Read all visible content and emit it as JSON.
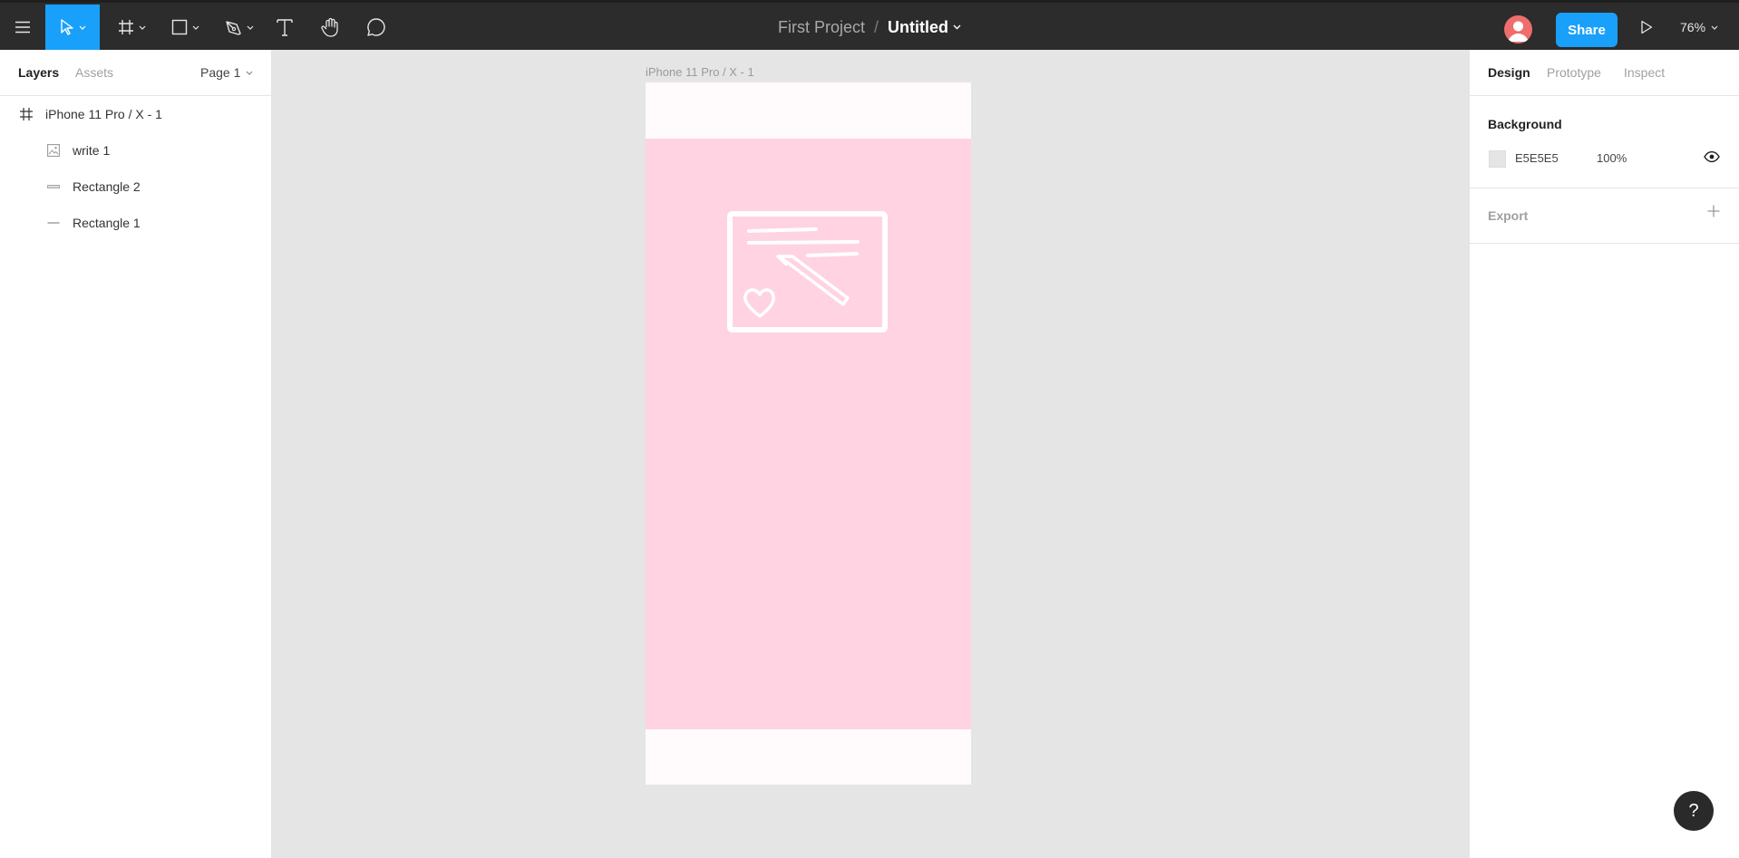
{
  "toolbar": {
    "project_name": "First Project",
    "separator": "/",
    "file_name": "Untitled",
    "share_label": "Share",
    "zoom_level": "76%",
    "tools": [
      "menu-icon",
      "move-tool-icon",
      "frame-tool-icon",
      "shape-tool-icon",
      "pen-tool-icon",
      "text-tool-icon",
      "hand-tool-icon",
      "comment-tool-icon"
    ],
    "active_tool": "move-tool-icon",
    "accent": "#18a0fb",
    "avatar_color": "#ef6d6d"
  },
  "left_panel": {
    "tabs": [
      {
        "label": "Layers",
        "active": true
      },
      {
        "label": "Assets",
        "active": false
      }
    ],
    "page_selector": "Page 1",
    "layers": [
      {
        "label": "iPhone 11 Pro / X - 1",
        "icon": "frame-icon",
        "depth": 0
      },
      {
        "label": "write 1",
        "icon": "image-icon",
        "depth": 1
      },
      {
        "label": "Rectangle 2",
        "icon": "rectangle-layer-icon",
        "depth": 1
      },
      {
        "label": "Rectangle 1",
        "icon": "rectangle-layer-icon",
        "depth": 1
      }
    ]
  },
  "canvas": {
    "frame_label": "iPhone 11 Pro / X - 1",
    "frame_fill": "#fffafc",
    "rectangle_fill": "#ffd3e2",
    "image_icon": "write-illustration-icon"
  },
  "right_panel": {
    "tabs": [
      {
        "label": "Design",
        "active": true
      },
      {
        "label": "Prototype",
        "active": false
      },
      {
        "label": "Inspect",
        "active": false
      }
    ],
    "background": {
      "title": "Background",
      "hex": "E5E5E5",
      "opacity": "100%",
      "swatch_color": "#e5e5e5"
    },
    "export": {
      "title": "Export"
    }
  },
  "help_label": "?"
}
